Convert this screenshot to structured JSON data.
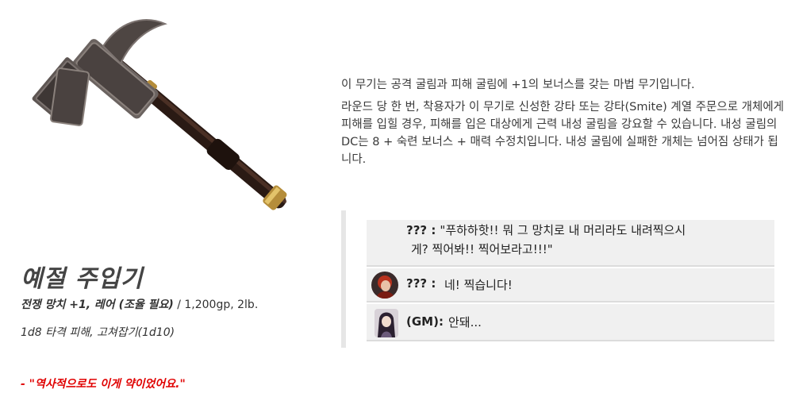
{
  "description": {
    "para1": " 이 무기는 공격 굴림과 피해 굴림에 +1의 보너스를 갖는 마법 무기입니다.",
    "para2": " 라운드 당 한 번, 착용자가 이 무기로 신성한 강타 또는 강타(Smite) 계열 주문으로 개체에게 피해를 입힐 경우, 피해를 입은 대상에게 근력 내성 굴림을 강요할 수 있습니다. 내성 굴림의 DC는 8 + 숙련 보너스 + 매력 수정치입니다. 내성 굴림에 실패한 개체는 넘어짐 상태가 됩니다."
  },
  "item": {
    "name": "예절 주입기",
    "type_bold": "전쟁 망치 +1, 레어 (조율 필요)",
    "type_rest": " / 1,200gp, 2lb.",
    "damage": "1d8 타격 피해, 고쳐잡기(1d10)",
    "quote": "- \"역사적으로도 이게 약이었어요.\""
  },
  "chat": {
    "messages": [
      {
        "speaker": "??? :",
        "line1": "\"푸하하핫!! 뭐 그 망치로 내 머리라도 내려찍으시",
        "line2": "게? 찍어봐!! 찍어보라고!!!\""
      },
      {
        "speaker": "??? :",
        "text": "네! 찍습니다!",
        "avatar": "red-haired-character-avatar"
      },
      {
        "speaker": "(GM):",
        "text": "안돼...",
        "avatar": "gm-character-avatar"
      }
    ]
  },
  "colors": {
    "quote": "#e00000",
    "chat_bg": "#f0f0f0",
    "chat_bar": "#e6e6e6"
  },
  "icons": {
    "weapon": "warhammer-illustration"
  }
}
